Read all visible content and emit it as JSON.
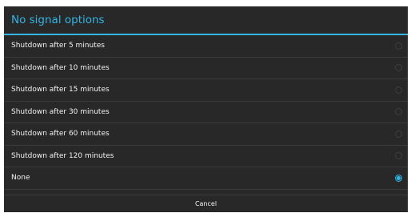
{
  "dialog": {
    "title": "No signal options",
    "options": [
      {
        "label": "Shutdown after 5 minutes",
        "selected": false
      },
      {
        "label": "Shutdown after 10 minutes",
        "selected": false
      },
      {
        "label": "Shutdown after 15 minutes",
        "selected": false
      },
      {
        "label": "Shutdown after 30 minutes",
        "selected": false
      },
      {
        "label": "Shutdown after 60 minutes",
        "selected": false
      },
      {
        "label": "Shutdown after 120 minutes",
        "selected": false
      },
      {
        "label": "None",
        "selected": true
      }
    ],
    "cancel_label": "Cancel"
  },
  "colors": {
    "accent": "#33b5e5",
    "dialog_background": "#282828",
    "text": "#f2f2f2"
  }
}
